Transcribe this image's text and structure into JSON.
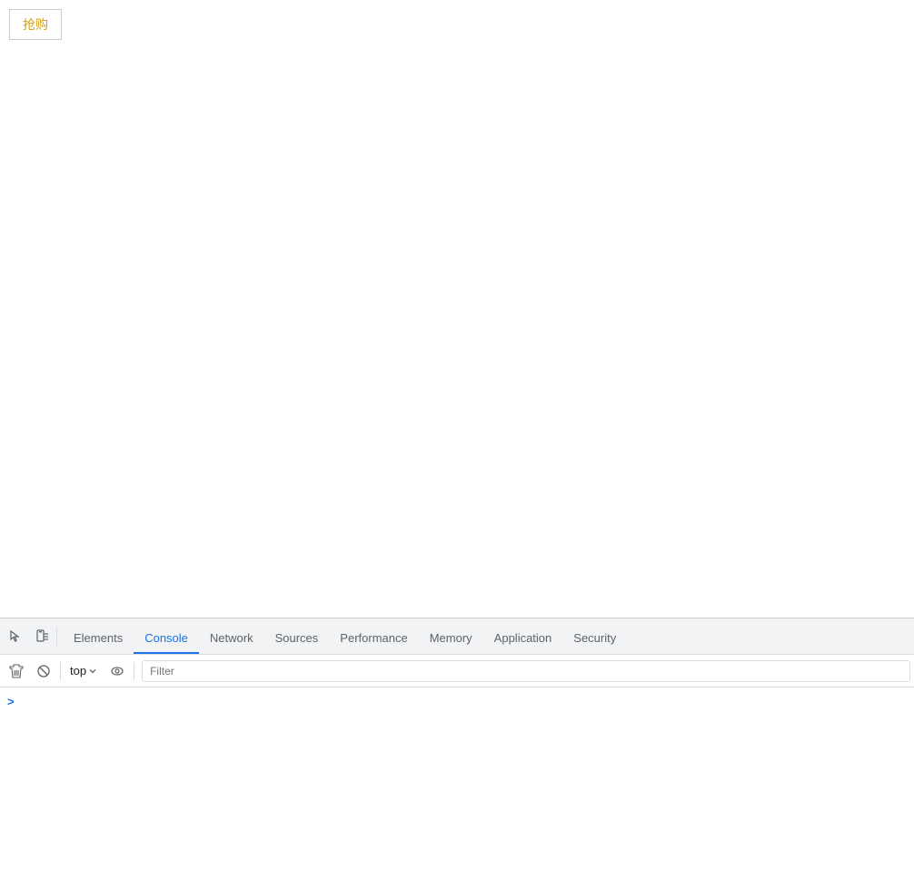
{
  "page": {
    "buy_button_label": "抢购"
  },
  "devtools": {
    "toolbar_icons": [
      {
        "name": "inspect-element-icon",
        "symbol": "⊹"
      },
      {
        "name": "device-toolbar-icon",
        "symbol": "▣"
      }
    ],
    "tabs": [
      {
        "id": "tab-elements",
        "label": "Elements",
        "active": false
      },
      {
        "id": "tab-console",
        "label": "Console",
        "active": true
      },
      {
        "id": "tab-network",
        "label": "Network",
        "active": false
      },
      {
        "id": "tab-sources",
        "label": "Sources",
        "active": false
      },
      {
        "id": "tab-performance",
        "label": "Performance",
        "active": false
      },
      {
        "id": "tab-memory",
        "label": "Memory",
        "active": false
      },
      {
        "id": "tab-application",
        "label": "Application",
        "active": false
      },
      {
        "id": "tab-security",
        "label": "Security",
        "active": false
      }
    ],
    "console": {
      "icons": [
        {
          "name": "clear-console-icon",
          "symbol": "▷"
        },
        {
          "name": "block-requests-icon",
          "symbol": "🚫"
        }
      ],
      "top_dropdown_label": "top",
      "eye_icon_symbol": "👁",
      "filter_placeholder": "Filter",
      "prompt_caret": ">"
    }
  }
}
